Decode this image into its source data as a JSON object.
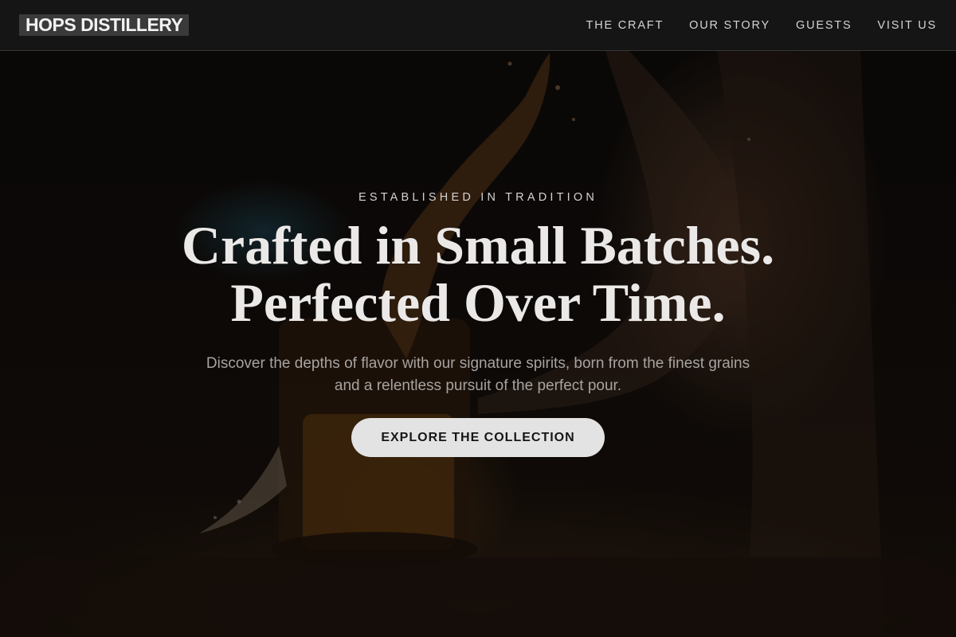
{
  "nav": {
    "brand": "HOPS DISTILLERY",
    "links": [
      "THE CRAFT",
      "OUR STORY",
      "GUESTS",
      "VISIT US"
    ]
  },
  "hero": {
    "eyebrow": "ESTABLISHED IN TRADITION",
    "headline_line1": "Crafted in Small Batches.",
    "headline_line2": "Perfected Over Time.",
    "subtext": "Discover the depths of flavor with our signature spirits, born from the finest grains and a relentless pursuit of the perfect pour.",
    "cta_label": "EXPLORE THE COLLECTION"
  },
  "colors": {
    "nav_background": "#161616",
    "cta_background": "#e3e3e3",
    "cta_text": "#161616",
    "headline": "#ebe9e7",
    "subtext": "#a7a3a0"
  }
}
